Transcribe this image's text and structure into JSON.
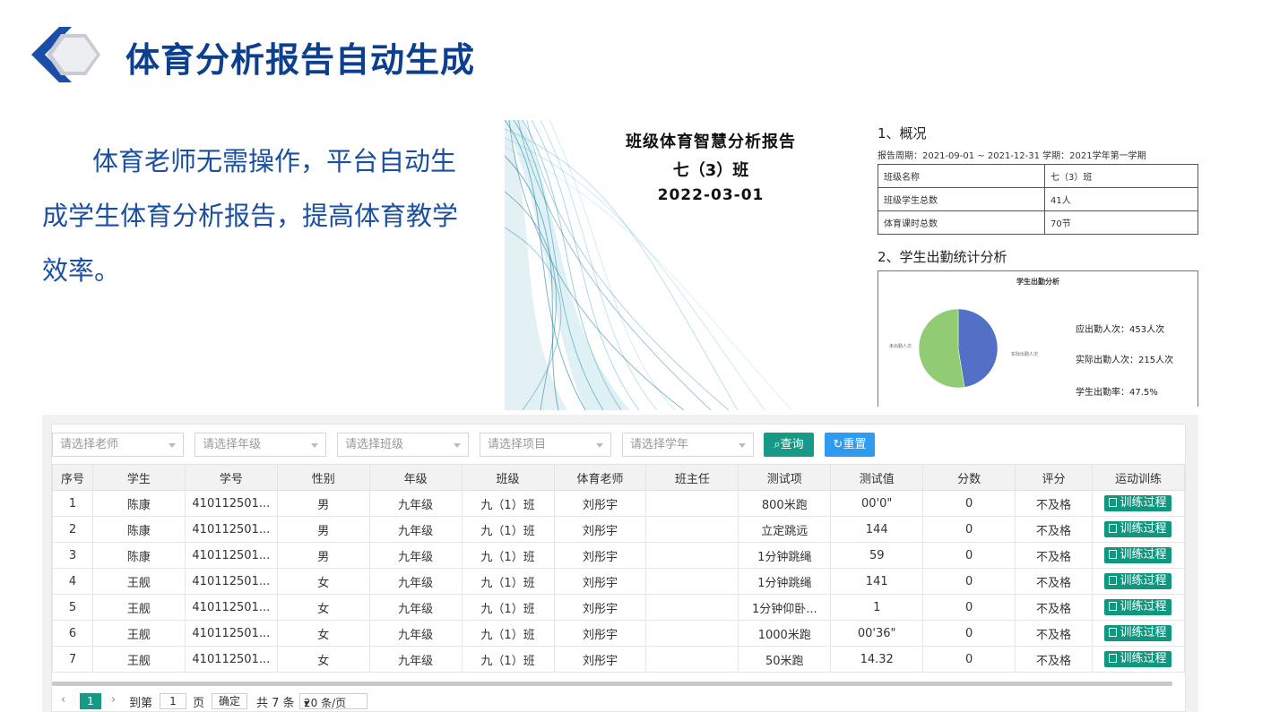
{
  "header": {
    "title": "体育分析报告自动生成"
  },
  "intro": {
    "text": "体育老师无需操作，平台自动生成学生体育分析报告，提高体育教学效率。"
  },
  "cover": {
    "title": "班级体育智慧分析报告",
    "class_name": "七（3）班",
    "date": "2022-03-01"
  },
  "report": {
    "section1_title": "1、概况",
    "meta": "报告周期：2021-09-01 ~ 2021-12-31 学期：2021学年第一学期",
    "overview": [
      {
        "label": "班级名称",
        "value": "七（3）班"
      },
      {
        "label": "班级学生总数",
        "value": "41人"
      },
      {
        "label": "体育课时总数",
        "value": "70节"
      }
    ],
    "section2_title": "2、学生出勤统计分析",
    "chart_data": {
      "type": "pie",
      "title": "学生出勤分析",
      "slices": [
        {
          "name": "实际出勤人次",
          "value": 215,
          "color": "#5470c6"
        },
        {
          "name": "未出勤人次",
          "value": 238,
          "color": "#91cc75"
        }
      ],
      "stats": {
        "expected": "应出勤人次：453人次",
        "actual": "实际出勤人次：215人次",
        "rate": "学生出勤率：47.5%"
      }
    }
  },
  "filters": [
    {
      "placeholder": "请选择老师"
    },
    {
      "placeholder": "请选择年级"
    },
    {
      "placeholder": "请选择班级"
    },
    {
      "placeholder": "请选择项目"
    },
    {
      "placeholder": "请选择学年"
    }
  ],
  "buttons": {
    "query": "查询",
    "reset": "重置"
  },
  "table": {
    "columns": [
      "序号",
      "学生",
      "学号",
      "性别",
      "年级",
      "班级",
      "体育老师",
      "班主任",
      "测试项",
      "测试值",
      "分数",
      "评分",
      "运动训练"
    ],
    "rows": [
      [
        "1",
        "陈康",
        "410112501...",
        "男",
        "九年级",
        "九（1）班",
        "刘彤宇",
        "",
        "800米跑",
        "00'0\"",
        "0",
        "不及格"
      ],
      [
        "2",
        "陈康",
        "410112501...",
        "男",
        "九年级",
        "九（1）班",
        "刘彤宇",
        "",
        "立定跳远",
        "144",
        "0",
        "不及格"
      ],
      [
        "3",
        "陈康",
        "410112501...",
        "男",
        "九年级",
        "九（1）班",
        "刘彤宇",
        "",
        "1分钟跳绳",
        "59",
        "0",
        "不及格"
      ],
      [
        "4",
        "王舰",
        "410112501...",
        "女",
        "九年级",
        "九（1）班",
        "刘彤宇",
        "",
        "1分钟跳绳",
        "141",
        "0",
        "不及格"
      ],
      [
        "5",
        "王舰",
        "410112501...",
        "女",
        "九年级",
        "九（1）班",
        "刘彤宇",
        "",
        "1分钟仰卧...",
        "1",
        "0",
        "不及格"
      ],
      [
        "6",
        "王舰",
        "410112501...",
        "女",
        "九年级",
        "九（1）班",
        "刘彤宇",
        "",
        "1000米跑",
        "00'36\"",
        "0",
        "不及格"
      ],
      [
        "7",
        "王舰",
        "410112501...",
        "女",
        "九年级",
        "九（1）班",
        "刘彤宇",
        "",
        "50米跑",
        "14.32",
        "0",
        "不及格"
      ]
    ],
    "action_label": "训练过程"
  },
  "pager": {
    "current_page": "1",
    "goto_label": "到第",
    "goto_value": "1",
    "page_unit": "页",
    "confirm": "确定",
    "total": "共 7 条",
    "page_size": "20 条/页"
  },
  "colors": {
    "title": "#0d3f8f",
    "intro": "#1b4fa0",
    "teal": "#169a87",
    "blue": "#2f9bf0"
  }
}
